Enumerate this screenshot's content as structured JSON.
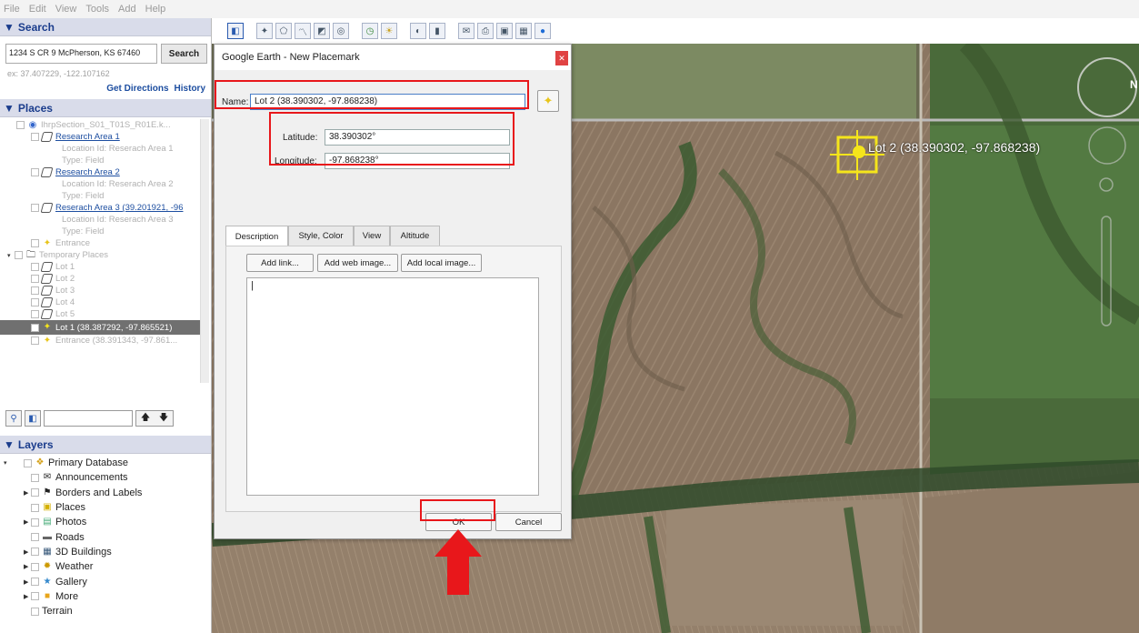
{
  "menu": [
    "File",
    "Edit",
    "View",
    "Tools",
    "Add",
    "Help"
  ],
  "search": {
    "header": "Search",
    "value": "1234 S CR 9 McPherson, KS 67460",
    "button": "Search",
    "hint": "ex: 37.407229, -122.107162",
    "directions_link": "Get Directions",
    "history_link": "History"
  },
  "places": {
    "header": "Places",
    "items": [
      {
        "label": "IhrpSection_S01_T01S_R01E.k..."
      },
      {
        "label": "Research Area 1"
      },
      {
        "label": "Location Id: Reserach Area 1"
      },
      {
        "label": "Type: Field"
      },
      {
        "label": "Research Area 2"
      },
      {
        "label": "Location Id: Reserach Area 2"
      },
      {
        "label": "Type: Field"
      },
      {
        "label": "Reserach Area 3 (39.201921, -96"
      },
      {
        "label": "Location Id: Reserach Area 3"
      },
      {
        "label": "Type: Field"
      },
      {
        "label": "Entrance"
      },
      {
        "label": "Temporary Places"
      },
      {
        "label": "Lot 1"
      },
      {
        "label": "Lot 2"
      },
      {
        "label": "Lot 3"
      },
      {
        "label": "Lot 4"
      },
      {
        "label": "Lot 5"
      },
      {
        "label": "Lot 1 (38.387292, -97.865521)"
      },
      {
        "label": "Entrance (38.391343, -97.861..."
      }
    ]
  },
  "layers": {
    "header": "Layers",
    "items": [
      {
        "label": "Primary Database"
      },
      {
        "label": "Announcements"
      },
      {
        "label": "Borders and Labels"
      },
      {
        "label": "Places"
      },
      {
        "label": "Photos"
      },
      {
        "label": "Roads"
      },
      {
        "label": "3D Buildings"
      },
      {
        "label": "Weather"
      },
      {
        "label": "Gallery"
      },
      {
        "label": "More"
      },
      {
        "label": "Terrain"
      }
    ]
  },
  "dialog": {
    "title": "Google Earth - New Placemark",
    "name_label": "Name:",
    "name_value": "Lot 2 (38.390302, -97.868238)",
    "latitude_label": "Latitude:",
    "latitude_value": "38.390302°",
    "longitude_label": "Longitude:",
    "longitude_value": "-97.868238°",
    "tabs": [
      "Description",
      "Style, Color",
      "View",
      "Altitude"
    ],
    "add_link": "Add link...",
    "add_web_image": "Add web image...",
    "add_local_image": "Add local image...",
    "ok": "OK",
    "cancel": "Cancel"
  },
  "map": {
    "placemark_label": "Lot 2 (38.390302, -97.868238)",
    "compass_letter": "N"
  },
  "colors": {
    "highlight_red": "#e8171b",
    "placemark_yellow": "#f5e51b",
    "panel_header": "#d9dcea",
    "link_blue": "#1d4ea0"
  }
}
